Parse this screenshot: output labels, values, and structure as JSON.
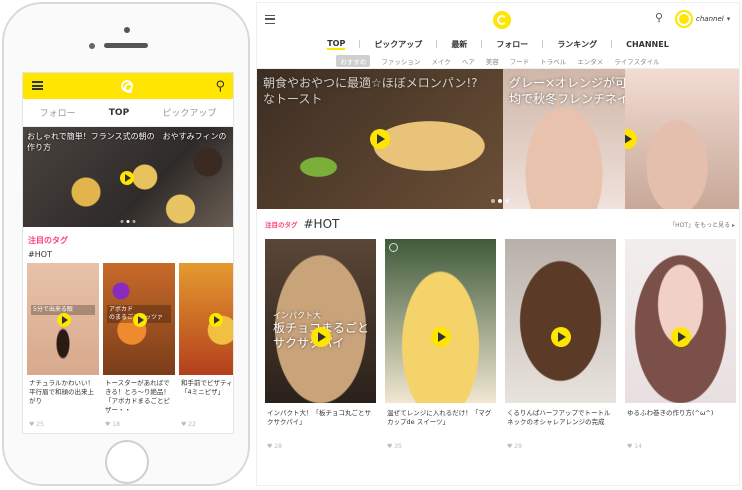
{
  "phone": {
    "header": {
      "search_icon": "search-icon",
      "menu_icon": "menu-icon",
      "brand_color": "#ffe600"
    },
    "tabs": [
      {
        "label": "フォロー",
        "active": false
      },
      {
        "label": "TOP",
        "active": true
      },
      {
        "label": "ピックアップ",
        "active": false
      }
    ],
    "hero": {
      "title": "おしゃれで簡単！フランス式の朝の　おやすみフィンの作り方"
    },
    "tag_heading": "注目のタグ",
    "hashtag": "#HOT",
    "cards": [
      {
        "overlay": "5分で出来る眼",
        "caption": "ナチュラルかわいい！平行眉で和顔の出来上がり",
        "likes": "25"
      },
      {
        "overlay": "アボカド\nのまるごとピッツァ",
        "caption": "トースターがあればできる！とろ～り絶品！「アボカドまるごとピザー・・",
        "likes": "18"
      },
      {
        "overlay": "",
        "caption": "和手前でピザティー！「4ミニピザ」",
        "likes": "22"
      }
    ]
  },
  "web": {
    "header": {
      "account_name": "channel",
      "search_icon": "search-icon",
      "menu_icon": "menu-icon"
    },
    "nav": [
      {
        "label": "TOP",
        "active": true
      },
      {
        "label": "ピックアップ",
        "active": false
      },
      {
        "label": "最新",
        "active": false
      },
      {
        "label": "フォロー",
        "active": false
      },
      {
        "label": "ランキング",
        "active": false
      },
      {
        "label": "CHANNEL",
        "active": false
      }
    ],
    "subnav": [
      {
        "label": "おすすめ",
        "active": true
      },
      {
        "label": "ファッション",
        "active": false
      },
      {
        "label": "メイク",
        "active": false
      },
      {
        "label": "ヘア",
        "active": false
      },
      {
        "label": "美容",
        "active": false
      },
      {
        "label": "フード",
        "active": false
      },
      {
        "label": "トラベル",
        "active": false
      },
      {
        "label": "エンタメ",
        "active": false
      },
      {
        "label": "ライフスタイル",
        "active": false
      }
    ],
    "slides": [
      {
        "title": "朝食やおやつに最適☆ほぼメロンパン!?\nなトースト"
      },
      {
        "title": "グレー×オレンジが可愛いんです。100\n均で秋冬フレンチネイル"
      },
      {
        "title": ""
      }
    ],
    "hot": {
      "label": "注目のタグ",
      "tag": "#HOT",
      "more": "「HOT」をもっと見る ▸"
    },
    "cards": [
      {
        "overlay_small": "インパクト大",
        "overlay": "板チョコまるごと\nサクサクパイ",
        "caption": "インパクト大！「板チョコ丸ごとサクサクパイ」",
        "likes": "28"
      },
      {
        "overlay_small": "",
        "overlay": "",
        "caption": "温ぜてレンジに入れるだけ！「マグカップde スイーツ」",
        "likes": "35"
      },
      {
        "overlay_small": "",
        "overlay": "",
        "caption": "くるりんぱハーフアップでトートルネックのオシャレアレンジの完成",
        "likes": "29"
      },
      {
        "overlay_small": "",
        "overlay": "",
        "caption": "ゆるふわ巻きの作り方(^ω^)",
        "likes": "14"
      }
    ]
  }
}
